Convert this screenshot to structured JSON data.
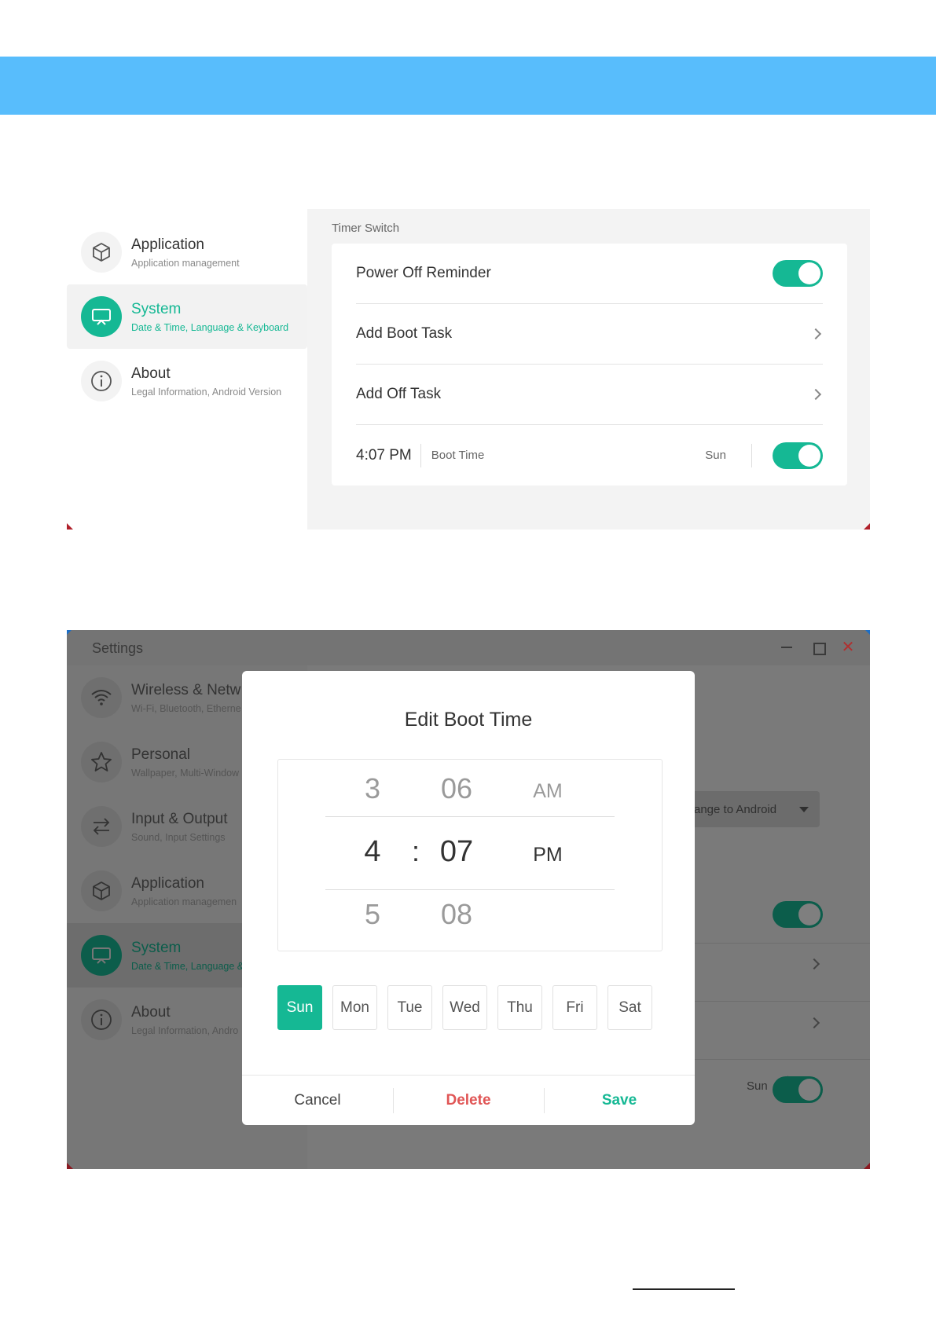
{
  "colors": {
    "accent": "#15b894",
    "header_band": "#58bdfc",
    "delete": "#e05555"
  },
  "shot1": {
    "sidebar": [
      {
        "title": "Application",
        "subtitle": "Application management",
        "icon": "cube-icon",
        "active": false
      },
      {
        "title": "System",
        "subtitle": "Date & Time, Language & Keyboard",
        "icon": "monitor-icon",
        "active": true
      },
      {
        "title": "About",
        "subtitle": "Legal Information, Android Version",
        "icon": "info-icon",
        "active": false
      }
    ],
    "section_label": "Timer Switch",
    "rows": {
      "power_off_reminder": {
        "label": "Power Off Reminder",
        "toggle": "on"
      },
      "add_boot_task": {
        "label": "Add Boot Task"
      },
      "add_off_task": {
        "label": "Add Off Task"
      },
      "task": {
        "time": "4:07 PM",
        "type": "Boot Time",
        "days": "Sun",
        "toggle": "on"
      }
    }
  },
  "shot2": {
    "window_title": "Settings",
    "close_glyph": "✕",
    "sidebar": [
      {
        "title": "Wireless & Netw",
        "subtitle": "Wi-Fi, Bluetooth, Etherne",
        "icon": "wifi-icon"
      },
      {
        "title": "Personal",
        "subtitle": "Wallpaper, Multi-Window",
        "icon": "star-icon"
      },
      {
        "title": "Input & Output",
        "subtitle": "Sound, Input Settings",
        "icon": "swap-icon"
      },
      {
        "title": "Application",
        "subtitle": "Application managemen",
        "icon": "cube-icon"
      },
      {
        "title": "System",
        "subtitle": "Date & Time, Language &",
        "icon": "monitor-icon",
        "active": true
      },
      {
        "title": "About",
        "subtitle": "Legal Information, Andro",
        "icon": "info-icon"
      }
    ],
    "dropdown_partial": "ange to Android",
    "bg_task_days": "Sun",
    "dialog": {
      "title": "Edit Boot Time",
      "picker": {
        "hour_prev": "3",
        "hour_sel": "4",
        "hour_next": "5",
        "separator": ":",
        "min_prev": "06",
        "min_sel": "07",
        "min_next": "08",
        "ampm_prev": "AM",
        "ampm_sel": "PM"
      },
      "days": [
        {
          "label": "Sun",
          "selected": true
        },
        {
          "label": "Mon",
          "selected": false
        },
        {
          "label": "Tue",
          "selected": false
        },
        {
          "label": "Wed",
          "selected": false
        },
        {
          "label": "Thu",
          "selected": false
        },
        {
          "label": "Fri",
          "selected": false
        },
        {
          "label": "Sat",
          "selected": false
        }
      ],
      "buttons": {
        "cancel": "Cancel",
        "delete": "Delete",
        "save": "Save"
      }
    }
  }
}
